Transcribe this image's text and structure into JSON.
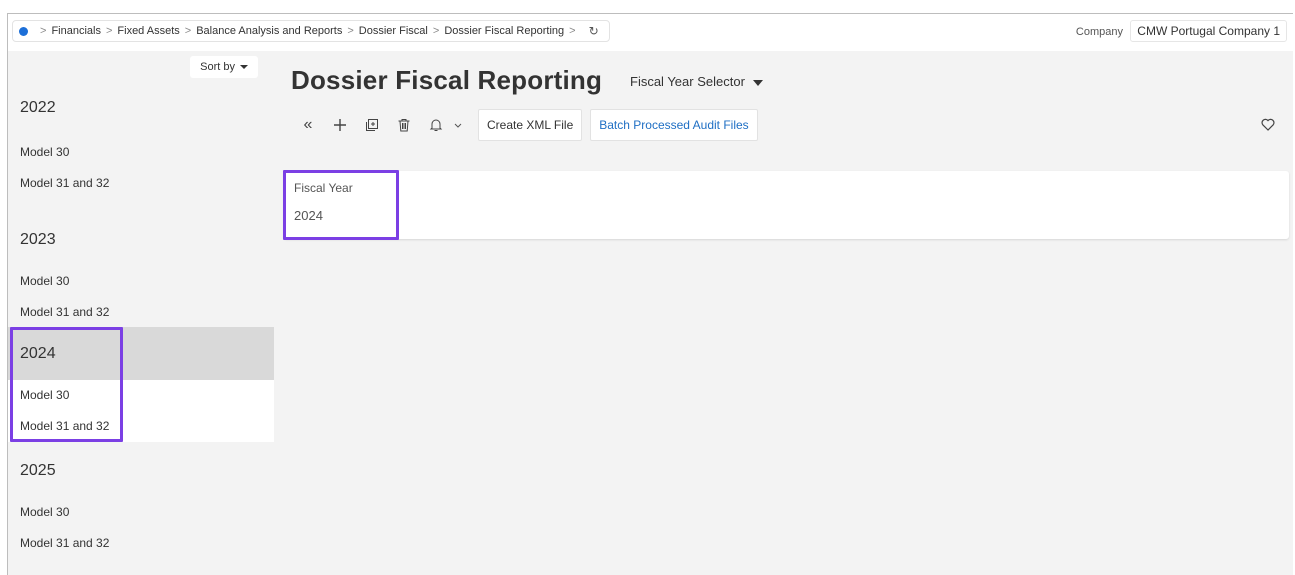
{
  "breadcrumb": {
    "items": [
      "Financials",
      "Fixed Assets",
      "Balance Analysis and Reports",
      "Dossier Fiscal",
      "Dossier Fiscal Reporting"
    ]
  },
  "company": {
    "label": "Company",
    "value": "CMW Portugal Company 1"
  },
  "sidebar": {
    "sort_label": "Sort by",
    "groups": [
      {
        "year": "2022",
        "models": [
          "Model 30",
          "Model 31 and 32"
        ]
      },
      {
        "year": "2023",
        "models": [
          "Model 30",
          "Model 31 and 32"
        ]
      },
      {
        "year": "2024",
        "models": [
          "Model 30",
          "Model 31 and 32"
        ],
        "selected": true
      },
      {
        "year": "2025",
        "models": [
          "Model 30",
          "Model 31 and 32"
        ]
      }
    ]
  },
  "header": {
    "title": "Dossier Fiscal Reporting",
    "selector_label": "Fiscal Year Selector"
  },
  "toolbar": {
    "icons": [
      "collapse-icon",
      "add-icon",
      "duplicate-icon",
      "delete-icon",
      "bell-icon"
    ],
    "create_xml_label": "Create XML File",
    "batch_label": "Batch Processed Audit Files"
  },
  "form": {
    "fiscal_year_label": "Fiscal Year",
    "fiscal_year_value": "2024"
  },
  "colors": {
    "highlight": "#7b3fe4",
    "accent": "#1d6fd8",
    "link": "#1f6fc4"
  }
}
